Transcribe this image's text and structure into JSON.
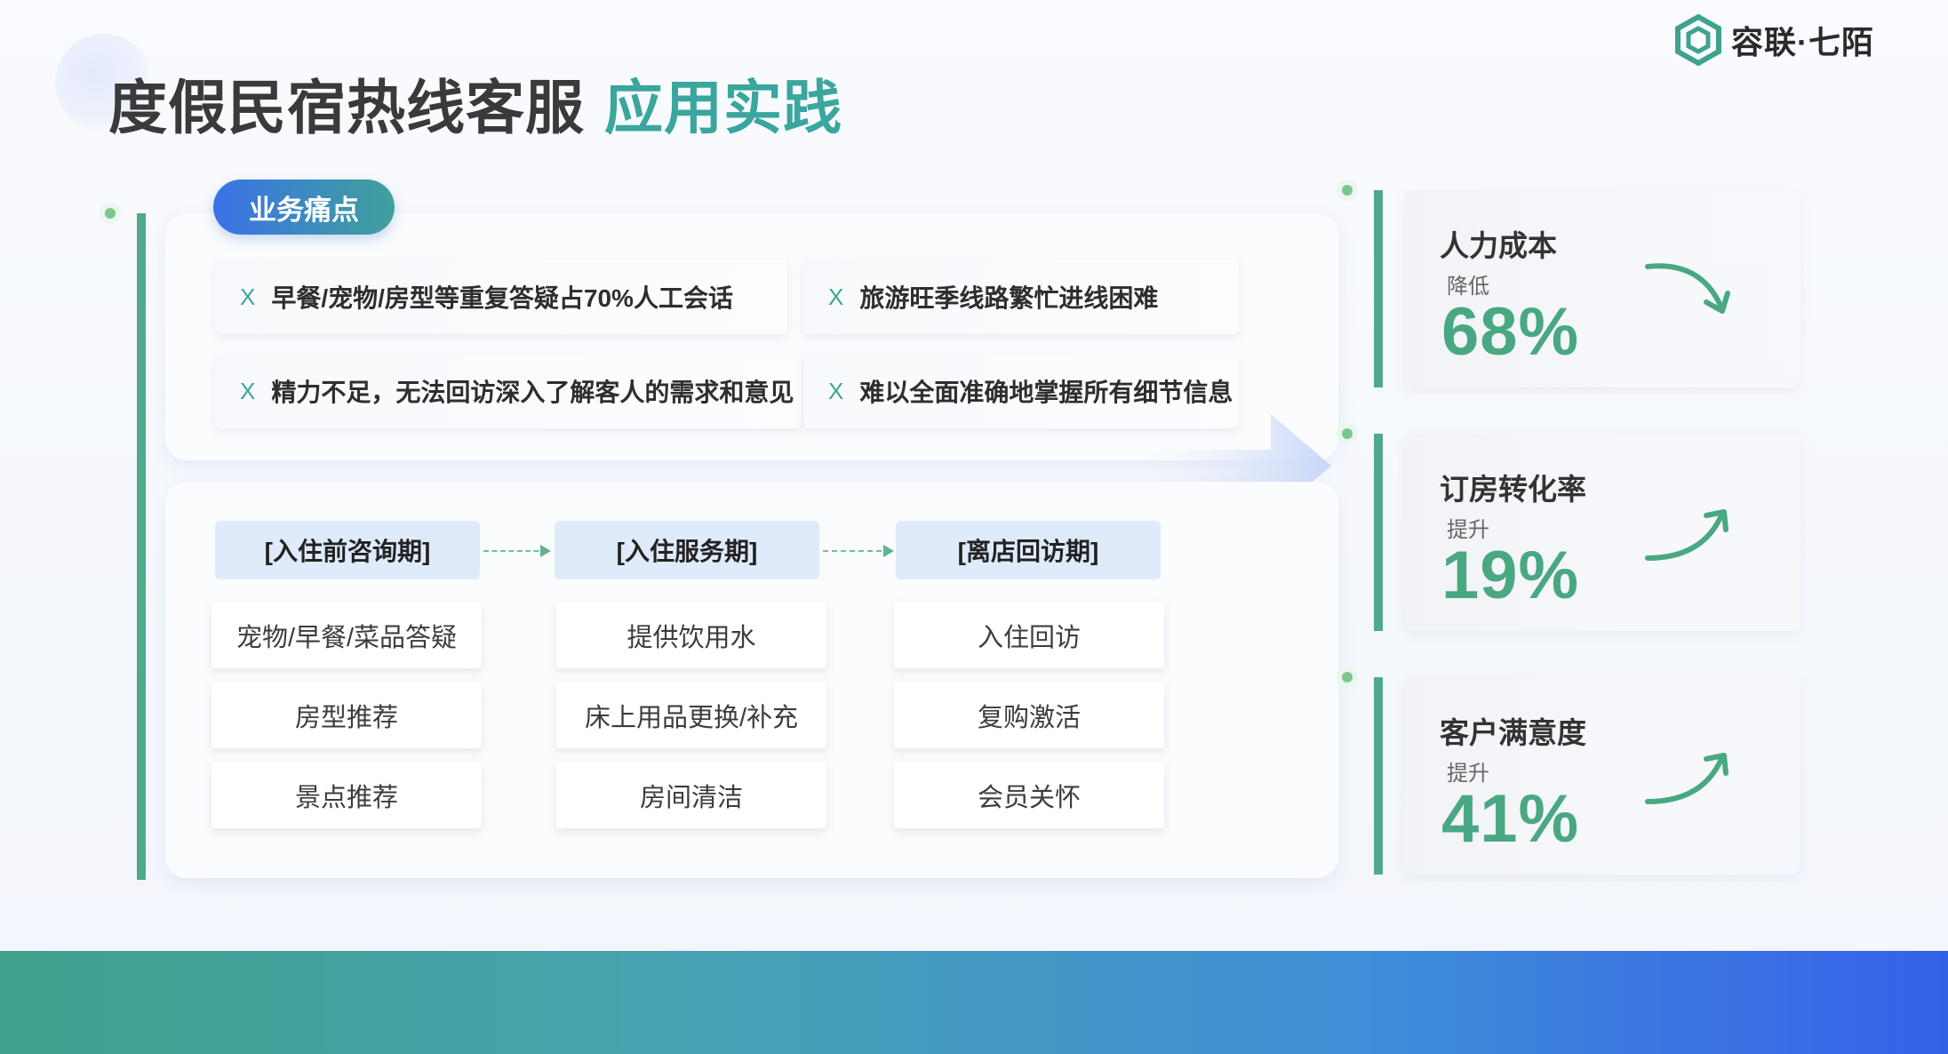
{
  "title": {
    "main": "度假民宿热线客服",
    "accent": "应用实践"
  },
  "logo": {
    "text": "容联·七陌"
  },
  "pain": {
    "tag": "业务痛点",
    "items": [
      "早餐/宠物/房型等重复答疑占70%人工会话",
      "旅游旺季线路繁忙进线困难",
      "精力不足，无法回访深入了解客人的需求和意见",
      "难以全面准确地掌握所有细节信息"
    ],
    "marker": "X"
  },
  "phases": [
    {
      "head": "[入住前咨询期]",
      "items": [
        "宠物/早餐/菜品答疑",
        "房型推荐",
        "景点推荐"
      ]
    },
    {
      "head": "[入住服务期]",
      "items": [
        "提供饮用水",
        "床上用品更换/补充",
        "房间清洁"
      ]
    },
    {
      "head": "[离店回访期]",
      "items": [
        "入住回访",
        "复购激活",
        "会员关怀"
      ]
    }
  ],
  "metrics": [
    {
      "title": "人力成本",
      "sub": "降低",
      "value": "68%",
      "icon": "trend-down-icon"
    },
    {
      "title": "订房转化率",
      "sub": "提升",
      "value": "19%",
      "icon": "trend-up-icon"
    },
    {
      "title": "客户满意度",
      "sub": "提升",
      "value": "41%",
      "icon": "trend-up-icon"
    }
  ],
  "colors": {
    "accent": "#3aa69e",
    "green": "#4fa98a",
    "blue": "#3660e9"
  }
}
